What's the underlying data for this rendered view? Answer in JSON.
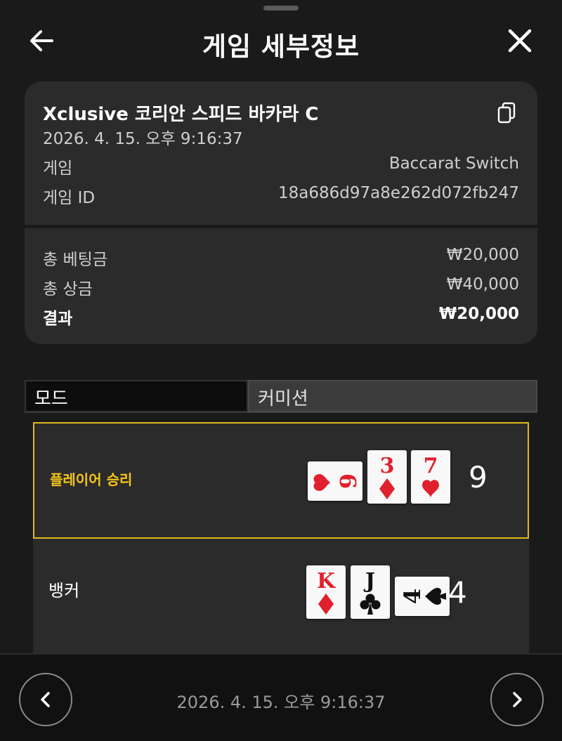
{
  "header": {
    "title": "게임 세부정보",
    "back_icon": "arrow-left-icon",
    "close_icon": "close-icon"
  },
  "summary": {
    "name": "Xclusive 코리안 스피드 바카라 C",
    "datetime": "2026. 4. 15. 오후 9:16:37",
    "game_label": "게임",
    "game_value": "Baccarat Switch",
    "game_id_label": "게임 ID",
    "game_id_value": "18a686d97a8e262d072fb247",
    "total_bet_label": "총 베팅금",
    "total_bet_value": "₩20,000",
    "total_win_label": "총 상금",
    "total_win_value": "₩40,000",
    "result_label": "결과",
    "result_value": "₩20,000"
  },
  "tabs": [
    {
      "label": "모드"
    },
    {
      "label": "커미션"
    }
  ],
  "hands": {
    "player": {
      "label": "플레이어 승리",
      "score": "9",
      "cards": [
        {
          "rank": "9",
          "suit": "♥",
          "rotated": true
        },
        {
          "rank": "3",
          "suit": "♦",
          "rotated": false
        },
        {
          "rank": "7",
          "suit": "♥",
          "rotated": false
        }
      ]
    },
    "banker": {
      "label": "뱅커",
      "score": "4",
      "cards": [
        {
          "rank": "K",
          "suit": "♦",
          "rotated": false
        },
        {
          "rank": "J",
          "suit": "♣",
          "rotated": false
        },
        {
          "rank": "4",
          "suit": "♠",
          "rotated": true
        }
      ]
    }
  },
  "footer": {
    "datetime": "2026. 4. 15. 오후 9:16:37"
  },
  "colors": {
    "accent": "#e3b81c",
    "background": "#1a1a1a",
    "card": "#2b2b2b",
    "red": "#e0202c"
  }
}
